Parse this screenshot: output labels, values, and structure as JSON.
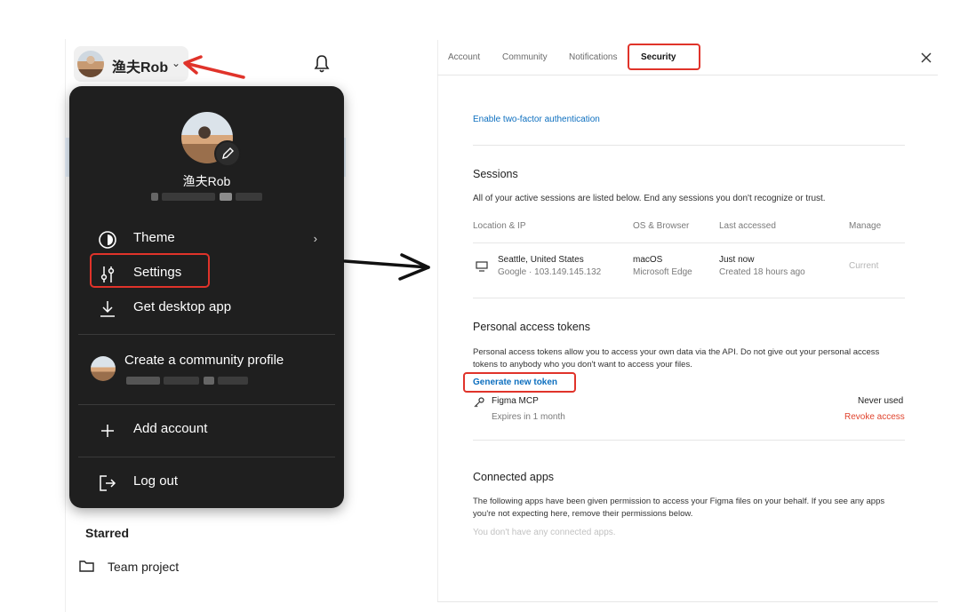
{
  "user": {
    "name": "渔夫Rob"
  },
  "menu": {
    "name": "渔夫Rob",
    "items": {
      "theme": "Theme",
      "settings": "Settings",
      "desktop": "Get desktop app",
      "community": "Create a community profile",
      "add_account": "Add account",
      "logout": "Log out"
    }
  },
  "sidebar": {
    "starred": "Starred",
    "team_project": "Team project"
  },
  "settings": {
    "tabs": {
      "account": "Account",
      "community": "Community",
      "notifications": "Notifications",
      "security": "Security"
    },
    "two_factor_link": "Enable two-factor authentication",
    "sessions": {
      "title": "Sessions",
      "description": "All of your active sessions are listed below. End any sessions you don't recognize or trust.",
      "columns": {
        "location": "Location & IP",
        "os": "OS & Browser",
        "last": "Last accessed",
        "manage": "Manage"
      },
      "row": {
        "location": "Seattle, United States",
        "ip": "Google · 103.149.145.132",
        "os": "macOS",
        "browser": "Microsoft Edge",
        "last": "Just now",
        "created": "Created 18 hours ago",
        "manage": "Current"
      }
    },
    "tokens": {
      "title": "Personal access tokens",
      "description": "Personal access tokens allow you to access your own data via the API. Do not give out your personal access tokens to anybody who you don't want to access your files.",
      "generate": "Generate new token",
      "token": {
        "name": "Figma MCP",
        "expiry": "Expires in 1 month",
        "usage": "Never used",
        "revoke": "Revoke access"
      }
    },
    "apps": {
      "title": "Connected apps",
      "description": "The following apps have been given permission to access your Figma files on your behalf. If you see any apps you're not expecting here, remove their permissions below.",
      "empty": "You don't have any connected apps."
    }
  },
  "colors": {
    "annotation_red": "#e0332a",
    "link_blue": "#0d6fbf",
    "revoke_red": "#e0442e",
    "menu_bg": "#1f1f1f"
  },
  "icons": [
    "bell-icon",
    "theme-icon",
    "settings-sliders-icon",
    "download-icon",
    "plus-icon",
    "logout-icon",
    "folder-icon",
    "close-icon",
    "monitor-icon",
    "link-icon",
    "pencil-icon",
    "chevron-down-icon",
    "chevron-right-icon"
  ]
}
